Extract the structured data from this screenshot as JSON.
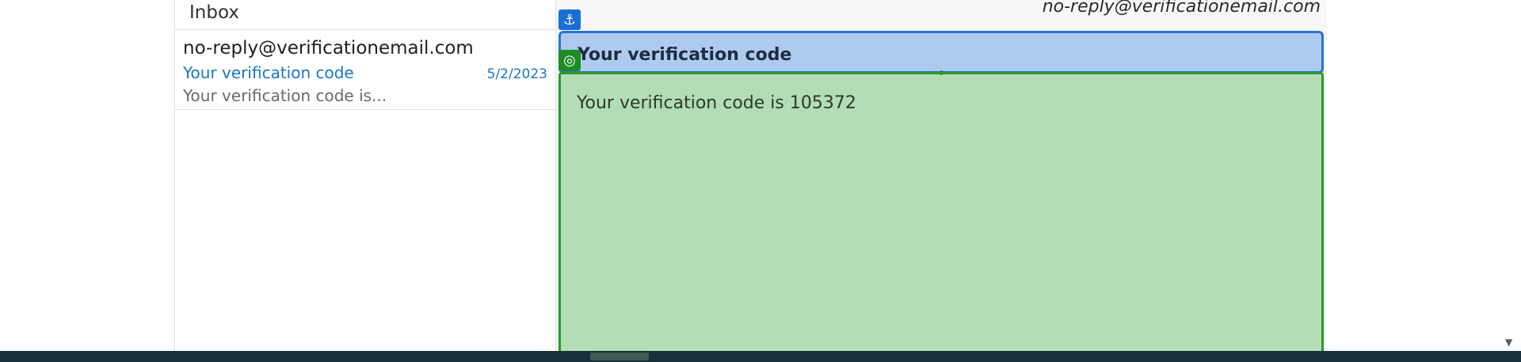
{
  "list": {
    "header": "Inbox",
    "messages": [
      {
        "from": "no-reply@verificationemail.com",
        "subject": "Your verification code",
        "date": "5/2/2023",
        "preview": "Your verification code is..."
      }
    ]
  },
  "reader": {
    "from": "no-reply@verificationemail.com",
    "subject": "Your verification code",
    "body": "Your verification code is 105372"
  },
  "icons": {
    "anchor": "⚓",
    "target": "◎",
    "scroll_down": "▼"
  },
  "colors": {
    "link_blue": "#1a75c9",
    "subject_highlight": "#aecbef",
    "body_highlight": "#b3ddb4"
  }
}
